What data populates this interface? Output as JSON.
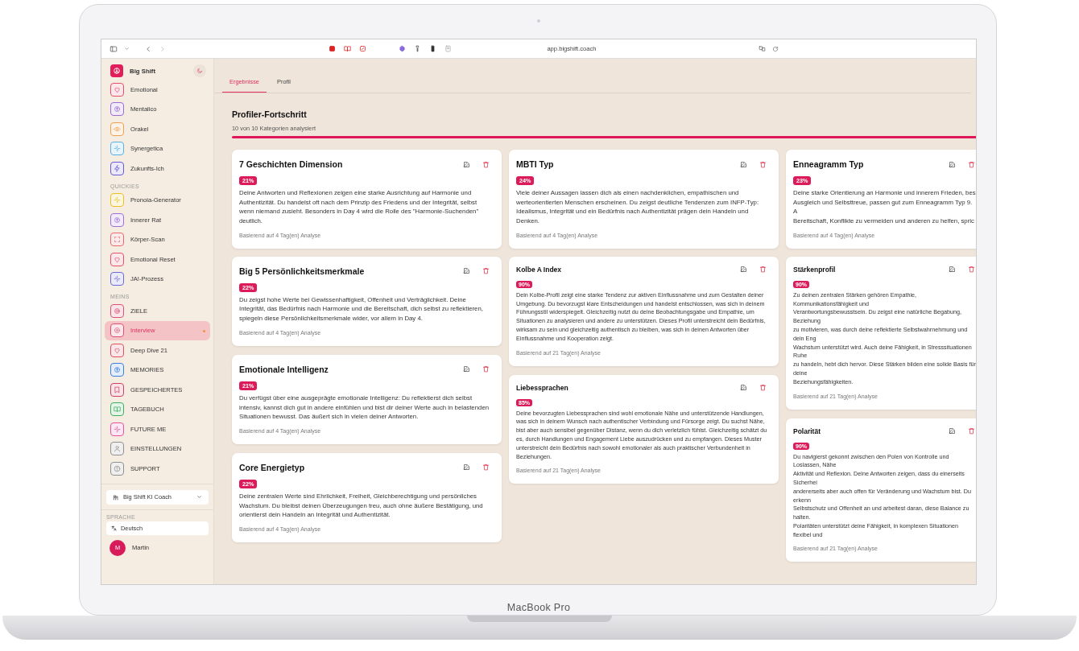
{
  "device": {
    "label": "MacBook Pro"
  },
  "browser": {
    "url": "app.bigshift.coach"
  },
  "sidebar": {
    "app_name": "Big Shift",
    "groups": [
      {
        "items": [
          {
            "label": "Emotional",
            "kind": "heart",
            "color": "#e8506a",
            "selected": false,
            "dot": false
          },
          {
            "label": "Mentalico",
            "kind": "brain",
            "color": "#9b6bd6",
            "selected": false,
            "dot": false
          },
          {
            "label": "Orakel",
            "kind": "eye",
            "color": "#f0a050",
            "selected": false,
            "dot": false
          },
          {
            "label": "Synergetica",
            "kind": "sparkle",
            "color": "#5ab0e0",
            "selected": false,
            "dot": false
          },
          {
            "label": "Zukunfts-Ich",
            "kind": "bolt",
            "color": "#6a5ad6",
            "selected": false,
            "dot": false
          }
        ]
      },
      {
        "heading": "QUICKIES",
        "items": [
          {
            "label": "Pronoia-Generator",
            "kind": "sparkle",
            "color": "#e8c020",
            "selected": false,
            "dot": false
          },
          {
            "label": "Innerer Rat",
            "kind": "brain",
            "color": "#a070d8",
            "selected": false,
            "dot": false
          },
          {
            "label": "Körper-Scan",
            "kind": "scan",
            "color": "#e86a6a",
            "selected": false,
            "dot": false
          },
          {
            "label": "Emotional Reset",
            "kind": "heart",
            "color": "#e8506a",
            "selected": false,
            "dot": false
          },
          {
            "label": "JA!-Prozess",
            "kind": "sparkle",
            "color": "#6a6ad8",
            "selected": false,
            "dot": false
          }
        ]
      },
      {
        "heading": "MEINS",
        "items": [
          {
            "label": "ZIELE",
            "kind": "target",
            "color": "#e05070",
            "selected": false,
            "dot": false
          },
          {
            "label": "Interview",
            "kind": "gear",
            "color": "#e05070",
            "selected": true,
            "dot": true
          },
          {
            "label": "Deep Dive 21",
            "kind": "heart",
            "color": "#e05060",
            "selected": false,
            "dot": false
          },
          {
            "label": "MEMORIES",
            "kind": "brain",
            "color": "#3a80e0",
            "selected": false,
            "dot": false
          },
          {
            "label": "GESPEICHERTES",
            "kind": "bookmark",
            "color": "#d04060",
            "selected": false,
            "dot": false
          },
          {
            "label": "TAGEBUCH",
            "kind": "book",
            "color": "#40b060",
            "selected": false,
            "dot": false
          },
          {
            "label": "FUTURE ME",
            "kind": "sparkle",
            "color": "#e850a0",
            "selected": false,
            "dot": false
          },
          {
            "label": "EINSTELLUNGEN",
            "kind": "person",
            "color": "#909090",
            "selected": false,
            "dot": false
          },
          {
            "label": "SUPPORT",
            "kind": "help",
            "color": "#909090",
            "selected": false,
            "dot": false
          }
        ]
      }
    ],
    "coach_select": {
      "value": "Big Shift KI Coach"
    },
    "language": {
      "heading": "SPRACHE",
      "value": "Deutsch"
    },
    "user": {
      "initial": "M",
      "name": "Martin"
    }
  },
  "tabs": [
    {
      "label": "Ergebnisse",
      "selected": true
    },
    {
      "label": "Profil",
      "selected": false
    }
  ],
  "progress": {
    "title": "Profiler-Fortschritt",
    "subtitle": "10 von 10 Kategorien analysiert",
    "level": 1.0
  },
  "columns": [
    [
      {
        "kind": "large",
        "title": "7 Geschichten Dimension",
        "percent": "21%",
        "text": "Deine Antworten und Reflexionen zeigen eine starke Ausrichtung auf Harmonie und Authentizität. Du handelst oft nach dem Prinzip des Friedens und der Integrität, selbst wenn niemand zusieht. Besonders in Day 4 wird die Rolle des \"Harmonie-Suchenden\" deutlich.",
        "footnote": "Basierend auf 4 Tag(en) Analyse"
      },
      {
        "kind": "large",
        "title": "Big 5 Persönlichkeitsmerkmale",
        "percent": "22%",
        "text": "Du zeigst hohe Werte bei Gewissenhaftigkeit, Offenheit und Verträglichkeit. Deine Integrität, das Bedürfnis nach Harmonie und die Bereitschaft, dich selbst zu reflektieren, spiegeln diese Persönlichkeitsmerkmale wider, vor allem in Day 4.",
        "footnote": "Basierend auf 4 Tag(en) Analyse"
      },
      {
        "kind": "large",
        "title": "Emotionale Intelligenz",
        "percent": "21%",
        "text": "Du verfügst über eine ausgeprägte emotionale Intelligenz: Du reflektierst dich selbst intensiv, kannst dich gut in andere einfühlen und bist dir deiner Werte auch in belastenden Situationen bewusst. Das äußert sich in vielen deiner Antworten.",
        "footnote": "Basierend auf 4 Tag(en) Analyse"
      },
      {
        "kind": "large",
        "title": "Core Energietyp",
        "percent": "22%",
        "text": "Deine zentralen Werte sind Ehrlichkeit, Freiheit, Gleichberechtigung und persönliches Wachstum. Du bleibst deinen Überzeugungen treu, auch ohne äußere Bestätigung, und orientierst dein Handeln an Integrität und Authentizität.",
        "footnote": "Basierend auf 4 Tag(en) Analyse"
      }
    ],
    [
      {
        "kind": "large",
        "title": "MBTI Typ",
        "percent": "24%",
        "text": "Viele deiner Aussagen lassen dich als einen nachdenklichen, empathischen und werteorientierten Menschen erscheinen. Du zeigst deutliche Tendenzen zum INFP-Typ: Idealismus, Integrität und ein Bedürfnis nach Authentizität prägen dein Handeln und Denken.",
        "footnote": "Basierend auf 4 Tag(en) Analyse"
      },
      {
        "kind": "compact",
        "title": "Kolbe A Index",
        "percent": "90%",
        "text": "Dein Kolbe-Profil zeigt eine starke Tendenz zur aktiven Einflussnahme und zum Gestalten deiner Umgebung. Du bevorzugst klare Entscheidungen und handelst entschlossen, was sich in deinem Führungsstil widerspiegelt. Gleichzeitig nutzt du deine Beobachtungsgabe und Empathie, um Situationen zu analysieren und andere zu unterstützen. Dieses Profil unterstreicht dein Bedürfnis, wirksam zu sein und gleichzeitig authentisch zu bleiben, was sich in deinen Antworten über Einflussnahme und Kooperation zeigt.",
        "footnote": "Basierend auf 21 Tag(en) Analyse"
      },
      {
        "kind": "compact",
        "title": "Liebessprachen",
        "percent": "85%",
        "text": "Deine bevorzugten Liebessprachen sind wohl emotionale Nähe und unterstützende Handlungen, was sich in deinem Wunsch nach authentischer Verbindung und Fürsorge zeigt. Du suchst Nähe, bist aber auch sensibel gegenüber Distanz, wenn du dich verletzlich fühlst. Gleichzeitig schätzt du es, durch Handlungen und Engagement Liebe auszudrücken und zu empfangen. Dieses Muster unterstreicht dein Bedürfnis nach sowohl emotionaler als auch praktischer Verbundenheit in Beziehungen.",
        "footnote": "Basierend auf 21 Tag(en) Analyse"
      }
    ],
    [
      {
        "kind": "large",
        "title": "Enneagramm Typ",
        "percent": "23%",
        "lines": [
          "Deine starke Orientierung an Harmonie und innerem Frieden, bes",
          "Ausgleich und Selbsttreue, passen gut zum Enneagramm Typ 9. A",
          "Bereitschaft, Konflikte zu vermeiden und anderen zu helfen, spric"
        ],
        "footnote": "Basierend auf 4 Tag(en) Analyse"
      },
      {
        "kind": "compact",
        "title": "Stärkenprofil",
        "percent": "90%",
        "lines": [
          "Zu deinen zentralen Stärken gehören Empathie, Kommunikationsfähigkeit und",
          "Verantwortungsbewusstsein. Du zeigst eine natürliche Begabung, Beziehung",
          "zu motivieren, was durch deine reflektierte Selbstwahrnehmung und dein Eng",
          "Wachstum unterstützt wird. Auch deine Fähigkeit, in Stresssituationen Ruhe",
          "zu handeln, hebt dich hervor. Diese Stärken bilden eine solide Basis für deine",
          "Beziehungsfähigkeiten."
        ],
        "footnote": "Basierend auf 21 Tag(en) Analyse"
      },
      {
        "kind": "compact",
        "title": "Polarität",
        "percent": "90%",
        "lines": [
          "Du navigierst gekonnt zwischen den Polen von Kontrolle und Loslassen, Nähe",
          "Aktivität und Reflexion. Deine Antworten zeigen, dass du einerseits Sicherhei",
          "andererseits aber auch offen für Veränderung und Wachstum bist. Du erkenn",
          "Selbstschutz und Offenheit an und arbeitest daran, diese Balance zu halten.",
          "Polaritäten unterstützt deine Fähigkeit, in komplexen Situationen flexibel und"
        ],
        "footnote": "Basierend auf 21 Tag(en) Analyse"
      }
    ]
  ]
}
